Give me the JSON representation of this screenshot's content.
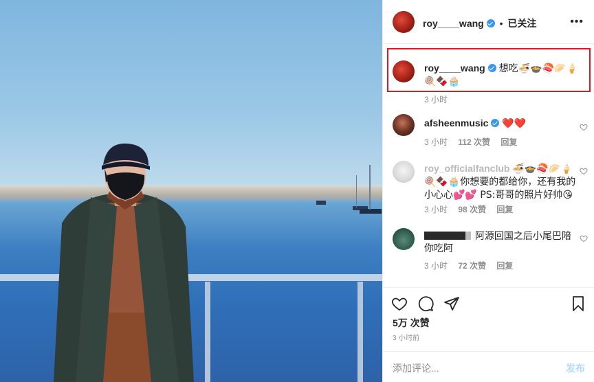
{
  "header": {
    "username": "roy____wang",
    "dot": "•",
    "follow_status": "已关注",
    "more": "•••"
  },
  "caption": {
    "username": "roy____wang",
    "text": "想吃🍜🍲🍣🥟🍦🍭🍫🧁",
    "time": "3 小时"
  },
  "comments": [
    {
      "username": "afsheenmusic",
      "text": "❤️❤️",
      "time": "3 小时",
      "likes": "112 次赞",
      "reply": "回复"
    },
    {
      "username": "roy_officialfanclub",
      "text": "🍜🍲🍣🥟🍦🍭🍫🧁你想要的都给你，还有我的小心心💕💕 PS:哥哥的照片好帅😘",
      "time": "3 小时",
      "likes": "98 次赞",
      "reply": "回复"
    },
    {
      "username": "",
      "text": "阿源回国之后小尾巴陪你吃阿",
      "time": "3 小时",
      "likes": "72 次赞",
      "reply": "回复"
    }
  ],
  "footer": {
    "likes": "5万 次赞",
    "time": "3 小时前",
    "comment_placeholder": "添加评论...",
    "post_label": "发布"
  },
  "colors": {
    "accent": "#3897f0",
    "highlight": "#e0171b",
    "muted": "#8e8e8e"
  }
}
